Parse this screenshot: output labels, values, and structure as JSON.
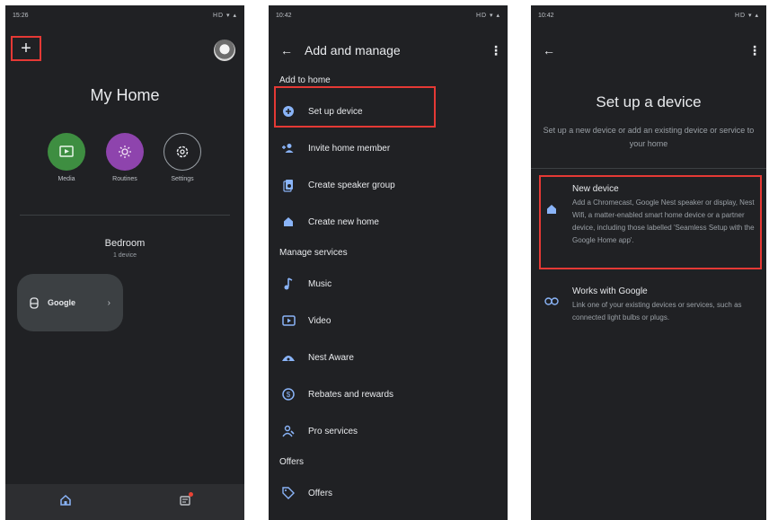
{
  "phone1": {
    "status_time": "15:26",
    "status_right": "HD ▾ ▴",
    "home_title": "My Home",
    "quick_actions": [
      {
        "label": "Media",
        "icon": "media-icon"
      },
      {
        "label": "Routines",
        "icon": "routines-icon"
      },
      {
        "label": "Settings",
        "icon": "settings-icon"
      }
    ],
    "room_name": "Bedroom",
    "room_count": "1 device",
    "device_name": "Google",
    "nav": [
      "home-icon",
      "activity-icon"
    ]
  },
  "phone2": {
    "status_time": "10:42",
    "status_right": "HD ▾ ▴",
    "title": "Add and manage",
    "section1": "Add to home",
    "items1": [
      {
        "label": "Set up device",
        "icon": "add-circle-icon"
      },
      {
        "label": "Invite home member",
        "icon": "person-add-icon"
      },
      {
        "label": "Create speaker group",
        "icon": "speaker-group-icon"
      },
      {
        "label": "Create new home",
        "icon": "home-icon"
      }
    ],
    "section2": "Manage services",
    "items2": [
      {
        "label": "Music",
        "icon": "music-note-icon"
      },
      {
        "label": "Video",
        "icon": "video-icon"
      },
      {
        "label": "Nest Aware",
        "icon": "nest-aware-icon"
      },
      {
        "label": "Rebates and rewards",
        "icon": "rebates-icon"
      },
      {
        "label": "Pro services",
        "icon": "pro-services-icon"
      }
    ],
    "section3": "Offers",
    "items3": [
      {
        "label": "Offers",
        "icon": "tag-icon"
      }
    ]
  },
  "phone3": {
    "status_time": "10:42",
    "status_right": "HD ▾ ▴",
    "title": "Set up a device",
    "subtitle": "Set up a new device or add an existing device or service to your home",
    "options": [
      {
        "title": "New device",
        "desc": "Add a Chromecast, Google Nest speaker or display, Nest Wifi, a matter-enabled smart home device or a partner device, including those labelled 'Seamless Setup with the Google Home app'.",
        "icon": "home-icon"
      },
      {
        "title": "Works with Google",
        "desc": "Link one of your existing devices or services, such as connected light bulbs or plugs.",
        "icon": "link-icon"
      }
    ]
  },
  "colors": {
    "bg": "#202124",
    "highlight": "#e53935",
    "accent": "#8ab4f8"
  }
}
